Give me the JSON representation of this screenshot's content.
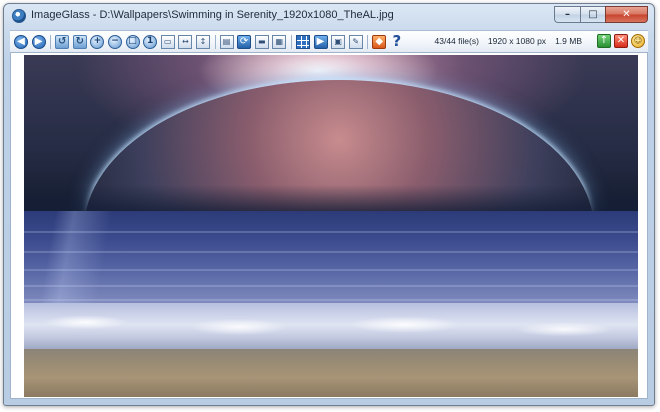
{
  "window": {
    "title": "ImageGlass - D:\\Wallpapers\\Swimming in Serenity_1920x1080_TheAL.jpg",
    "caption_buttons": {
      "minimize": "–",
      "maximize": "□",
      "close": "✕"
    }
  },
  "toolbar": {
    "icons": {
      "back": "◀",
      "forward": "▶",
      "rotate_left": "↺",
      "rotate_right": "↻",
      "zoom_in": "+",
      "zoom_out": "−",
      "zoom_fit": "□",
      "actual_size": "1",
      "zoom_lock": "▭",
      "scale_width": "↔",
      "scale_height": "↕",
      "open": "▤",
      "refresh": "⟳",
      "print": "▬",
      "wallpaper": "▦",
      "thumbnail": "",
      "slideshow": "▶",
      "extract_frames": "▣",
      "settings": "✎",
      "plugin": "◆",
      "help": "?"
    },
    "status": {
      "file_count": "43/44 file(s)",
      "dimensions": "1920 x 1080 px",
      "file_size": "1.9 MB"
    },
    "right_icons": {
      "upload": "↑",
      "ban": "✕",
      "smile": "☺"
    }
  },
  "viewer": {
    "image_alt": "Swimming in Serenity wallpaper: planet rising over ocean waves on a beach"
  },
  "colors": {
    "accent": "#1f5fae",
    "titlebar": "#c9d9ec",
    "close_button": "#c7432b"
  }
}
